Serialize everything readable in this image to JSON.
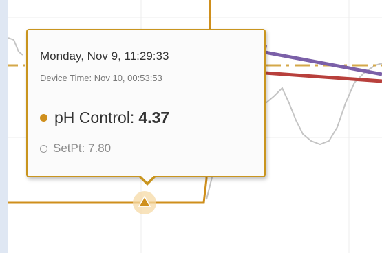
{
  "tooltip": {
    "date": "Monday, Nov 9, 11:29:33",
    "device_time": "Device Time: Nov 10, 00:53:53",
    "series_name": "pH Control:",
    "series_value": "4.37",
    "setpoint": "SetPt: 7.80"
  },
  "colors": {
    "series": "#cf8f1c",
    "setpoint_line": "#d4a84a",
    "secondary_line": "#c4c4c4",
    "arrow_purple": "#7b60a8",
    "arrow_red": "#b8403c",
    "background": "#dfe7f3"
  },
  "icons": {
    "series_marker": "triangle-marker-icon",
    "legend_filled": "filled-dot-icon",
    "legend_hollow": "hollow-dot-icon"
  }
}
